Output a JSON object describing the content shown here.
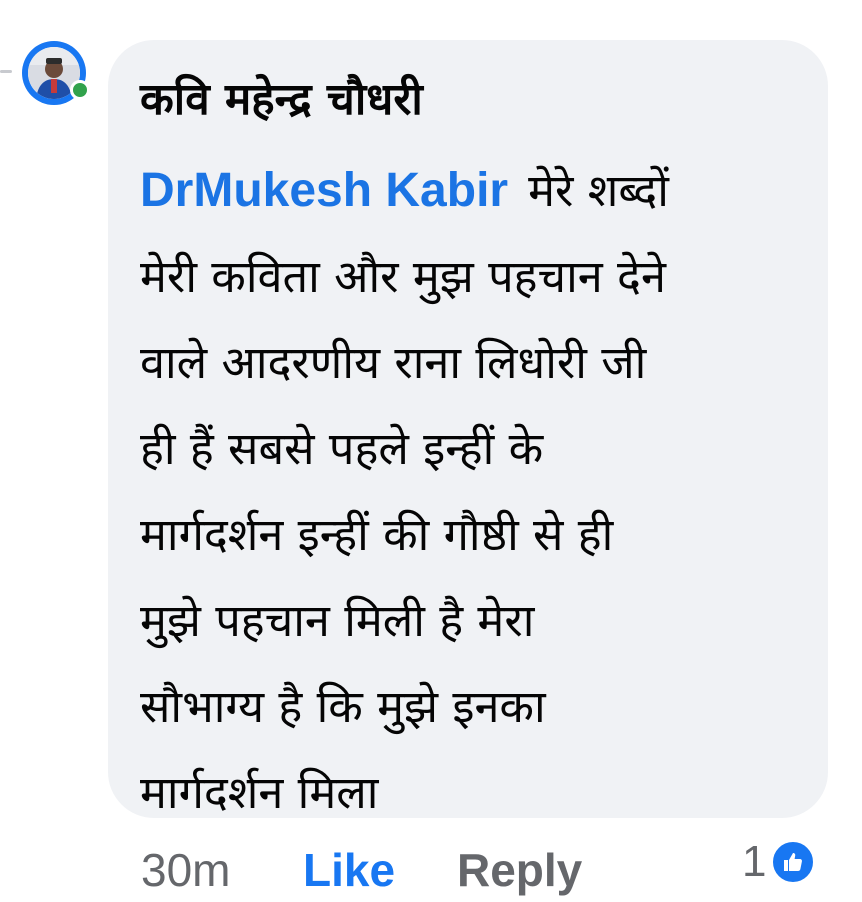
{
  "comment": {
    "author": "कवि महेन्द्र चौधरी",
    "mention": "DrMukesh Kabir",
    "text_lines": [
      "मेरे शब्दों",
      "मेरी कविता और मुझ पहचान देने",
      "वाले आदरणीय राना लिधोरी जी",
      "ही हैं सबसे पहले इन्हीं के",
      "मार्गदर्शन इन्हीं की गौष्ठी से ही",
      "मुझे पहचान मिली है मेरा",
      "सौभाग्य है कि मुझे इनका",
      "मार्गदर्शन मिला"
    ],
    "timestamp": "30m",
    "like_label": "Like",
    "reply_label": "Reply",
    "reaction_count": "1",
    "author_online": true
  },
  "icons": {
    "avatar": "avatar-photo",
    "presence": "online-dot",
    "reaction": "thumbs-up-icon"
  },
  "colors": {
    "bubble": "#f0f2f5",
    "mention": "#1b74e4",
    "like_active": "#1877f2",
    "online": "#31a24c",
    "meta_text": "#65676b"
  }
}
